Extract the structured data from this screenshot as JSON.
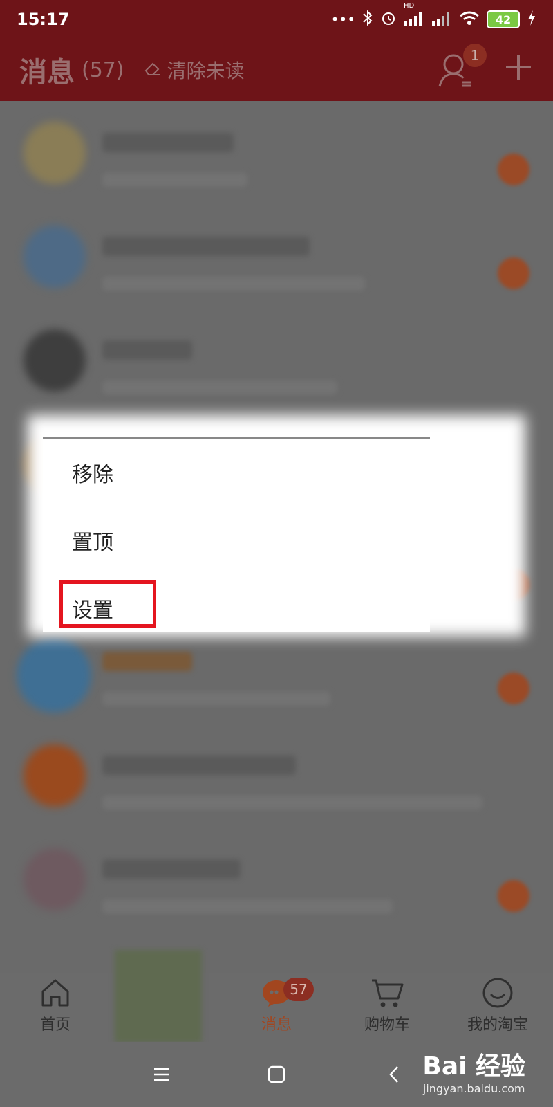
{
  "status_bar": {
    "time": "15:17",
    "icons": [
      "more-dots-icon",
      "bluetooth-icon",
      "alarm-icon",
      "signal-hd-icon",
      "signal-icon",
      "wifi-icon",
      "battery-icon",
      "charging-icon"
    ],
    "hd_label": "HD",
    "battery_level": "42"
  },
  "header": {
    "title": "消息",
    "count": "(57)",
    "clear_unread": "清除未读",
    "contacts_badge": "1"
  },
  "context_menu": {
    "items": [
      {
        "label": "移除"
      },
      {
        "label": "置顶"
      },
      {
        "label": "设置"
      }
    ],
    "highlighted_item": "设置",
    "highlight_color": "#e4151f"
  },
  "tab_bar": {
    "tabs": [
      {
        "label": "首页",
        "icon": "home-icon"
      },
      {
        "label": "消息",
        "icon": "message-bubble-icon",
        "badge": "57",
        "active": true
      },
      {
        "label": "购物车",
        "icon": "cart-icon"
      },
      {
        "label": "我的淘宝",
        "icon": "smile-icon"
      }
    ],
    "active_color": "#a2461f"
  },
  "nav_bar": {
    "buttons": [
      "menu-icon",
      "home-square-icon",
      "back-chevron-icon"
    ]
  },
  "watermark": {
    "brand": "Bai 经验",
    "url": "jingyan.baidu.com"
  }
}
